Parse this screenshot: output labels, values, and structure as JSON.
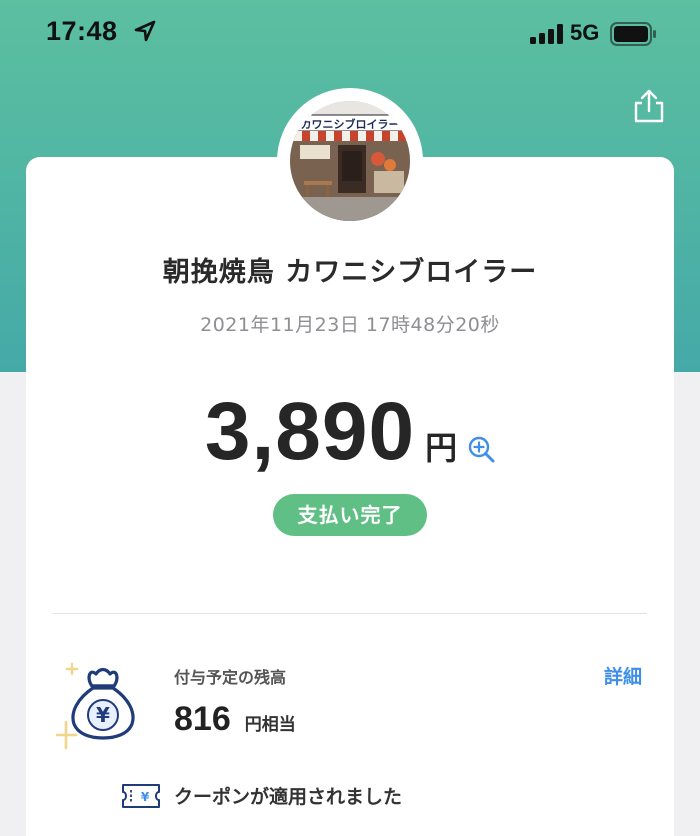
{
  "status_bar": {
    "time": "17:48",
    "network": "5G",
    "icons": [
      "location-arrow-icon",
      "signal-icon",
      "battery-icon"
    ]
  },
  "header": {
    "share_icon": "share-icon"
  },
  "receipt": {
    "shop_name": "朝挽焼鳥 カワニシブロイラー",
    "storefront_sign_text": "カワニシブロイラー",
    "datetime": "2021年11月23日 17時48分20秒",
    "amount": "3,890",
    "amount_unit": "円",
    "status": "支払い完了"
  },
  "points": {
    "label": "付与予定の残高",
    "value": "816",
    "unit": "円相当",
    "detail_link": "詳細"
  },
  "coupon": {
    "text": "クーポンが適用されました"
  },
  "colors": {
    "header_gradient_top": "#5cbfa0",
    "header_gradient_bottom": "#45a9a8",
    "status_green": "#5fbf84",
    "link_blue": "#3f8fe8",
    "icon_navy": "#1f3b7a"
  }
}
